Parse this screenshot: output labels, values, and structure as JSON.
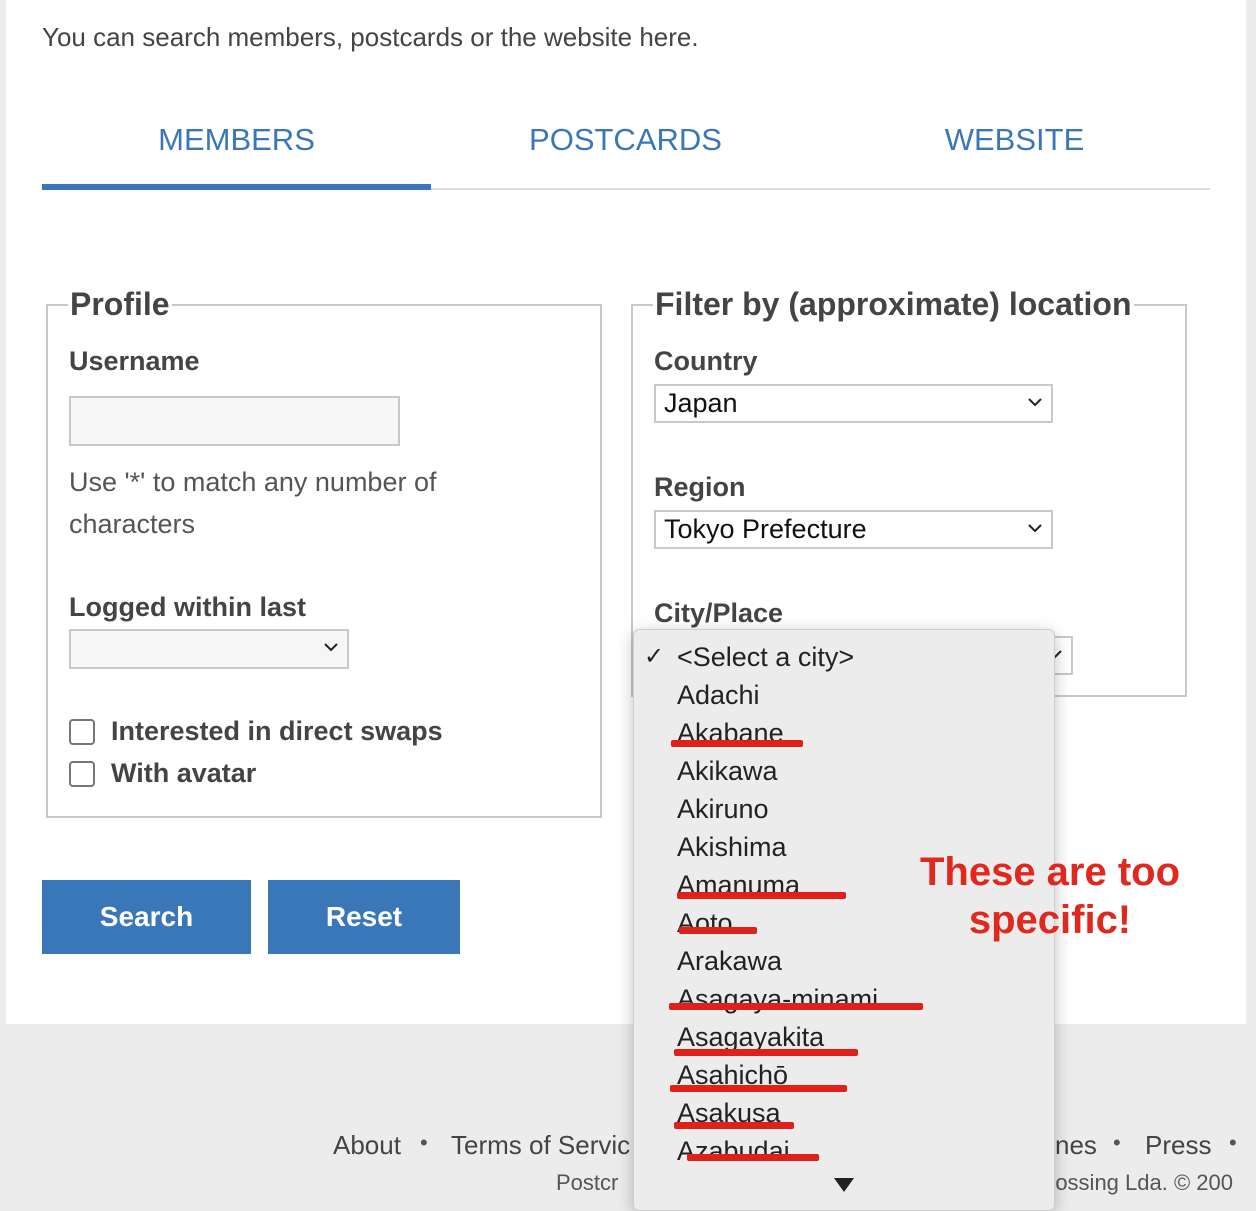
{
  "intro": "You can search members, postcards or the website here.",
  "tabs": [
    {
      "label": "MEMBERS",
      "active": true
    },
    {
      "label": "POSTCARDS",
      "active": false
    },
    {
      "label": "WEBSITE",
      "active": false
    }
  ],
  "profile": {
    "legend": "Profile",
    "username_label": "Username",
    "username_value": "",
    "hint": "Use '*' to match any number of characters",
    "logged_label": "Logged within last",
    "logged_value": "",
    "checkboxes": [
      {
        "label": "Interested in direct swaps",
        "checked": false
      },
      {
        "label": "With avatar",
        "checked": false
      }
    ]
  },
  "location": {
    "legend": "Filter by (approximate) location",
    "country_label": "Country",
    "country_value": "Japan",
    "region_label": "Region",
    "region_value": "Tokyo Prefecture",
    "city_label": "City/Place"
  },
  "buttons": {
    "search": "Search",
    "reset": "Reset"
  },
  "city_dropdown": {
    "selected_check": "✓",
    "items": [
      {
        "label": "<Select a city>",
        "selected": true,
        "struck": false
      },
      {
        "label": "Adachi",
        "selected": false,
        "struck": false
      },
      {
        "label": "Akabane",
        "selected": false,
        "struck": true
      },
      {
        "label": "Akikawa",
        "selected": false,
        "struck": false
      },
      {
        "label": "Akiruno",
        "selected": false,
        "struck": false
      },
      {
        "label": "Akishima",
        "selected": false,
        "struck": false
      },
      {
        "label": "Amanuma",
        "selected": false,
        "struck": true
      },
      {
        "label": "Aoto",
        "selected": false,
        "struck": true
      },
      {
        "label": "Arakawa",
        "selected": false,
        "struck": false
      },
      {
        "label": "Asagaya-minami",
        "selected": false,
        "struck": true
      },
      {
        "label": "Asagayakita",
        "selected": false,
        "struck": true
      },
      {
        "label": "Asahichō",
        "selected": false,
        "struck": true
      },
      {
        "label": "Asakusa",
        "selected": false,
        "struck": true
      },
      {
        "label": "Azabudai",
        "selected": false,
        "struck": true
      }
    ]
  },
  "annotation": {
    "text": "These are too specific!",
    "color": "#e0281f"
  },
  "footer": {
    "about": "About",
    "terms": "Terms of Servic",
    "partial_link": "nes",
    "press": "Press",
    "dot": "•",
    "copy_left": "Postcr",
    "copy_right": "rossing Lda. © 200"
  },
  "colors": {
    "accent": "#3a77b9",
    "annotation_red": "#e0201a"
  }
}
